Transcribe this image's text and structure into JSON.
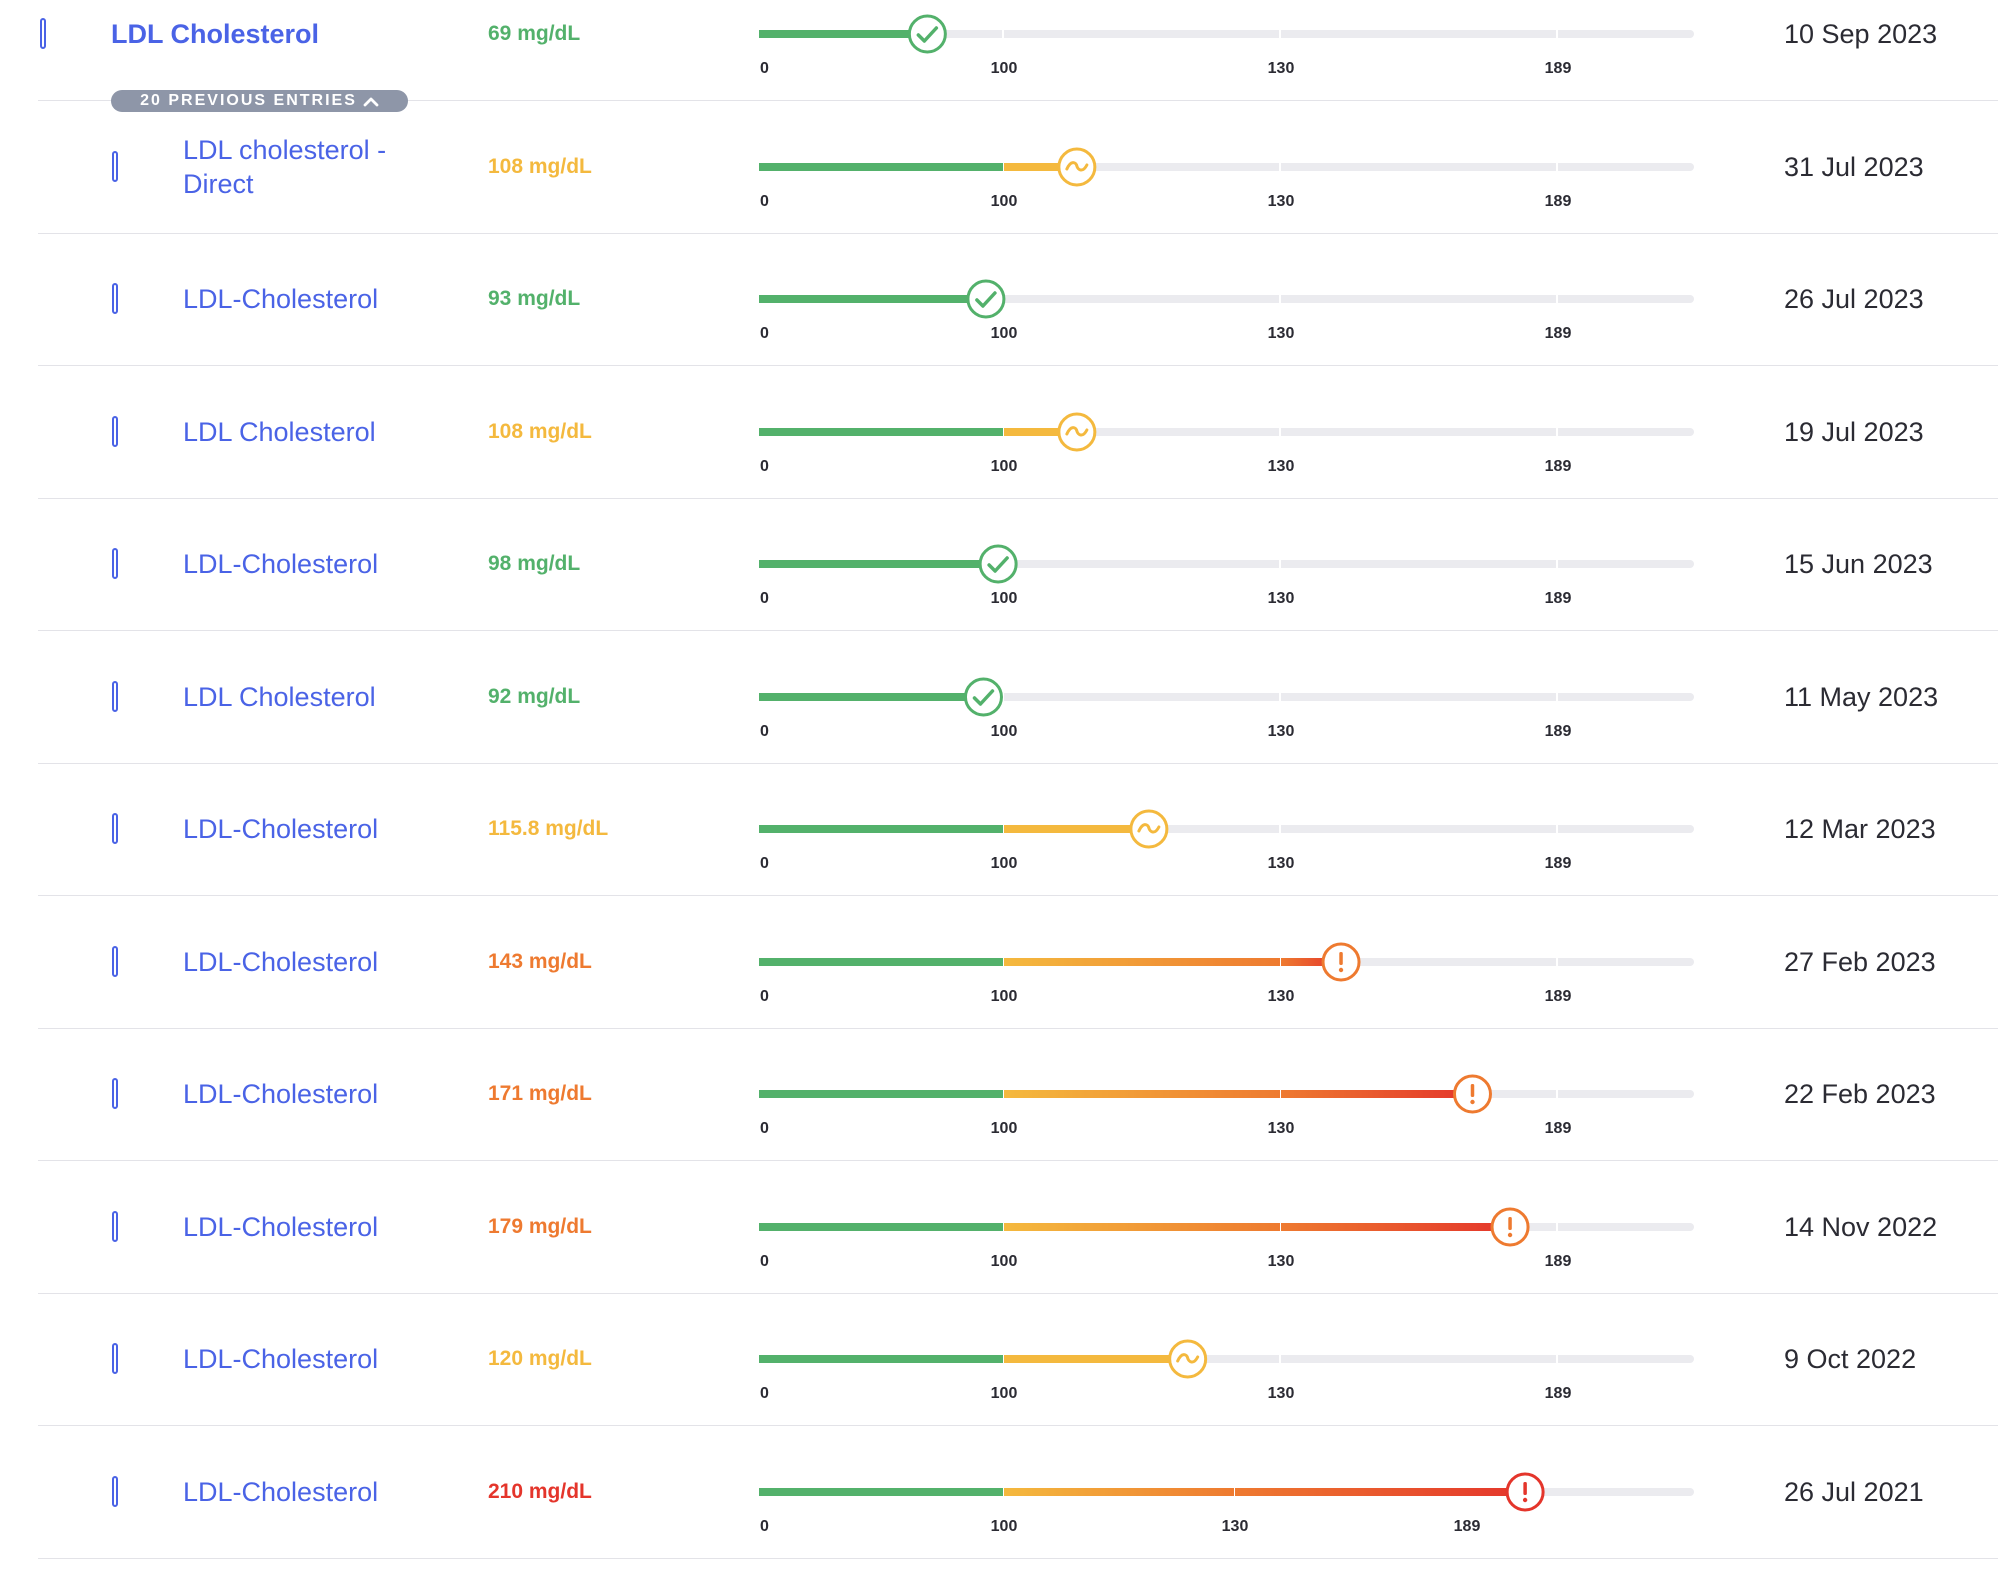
{
  "expander": {
    "label": "20 PREVIOUS ENTRIES",
    "icon": "chevron-up-icon"
  },
  "scale": {
    "ticks": [
      "0",
      "100",
      "130",
      "189"
    ],
    "domain": [
      0,
      270
    ]
  },
  "colors": {
    "name": "#4a63e6",
    "track": "#ebebef",
    "green": "#53b16b",
    "yellow": "#f4b93e",
    "orange": "#ee7a30",
    "red": "#e4352b",
    "date": "#2b2b33"
  },
  "entries": [
    {
      "name": "LDL Cholesterol",
      "value": 69,
      "value_text": "69 mg/dL",
      "status": "green",
      "icon": "check-icon",
      "date": "10 Sep 2023",
      "primary": true
    },
    {
      "name": "LDL cholesterol - Direct",
      "value": 108,
      "value_text": "108 mg/dL",
      "status": "yellow",
      "icon": "tilde-icon",
      "date": "31 Jul 2023"
    },
    {
      "name": "LDL-Cholesterol",
      "value": 93,
      "value_text": "93 mg/dL",
      "status": "green",
      "icon": "check-icon",
      "date": "26 Jul 2023"
    },
    {
      "name": "LDL Cholesterol",
      "value": 108,
      "value_text": "108 mg/dL",
      "status": "yellow",
      "icon": "tilde-icon",
      "date": "19 Jul 2023"
    },
    {
      "name": "LDL-Cholesterol",
      "value": 98,
      "value_text": "98 mg/dL",
      "status": "green",
      "icon": "check-icon",
      "date": "15 Jun 2023"
    },
    {
      "name": "LDL Cholesterol",
      "value": 92,
      "value_text": "92 mg/dL",
      "status": "green",
      "icon": "check-icon",
      "date": "11 May 2023"
    },
    {
      "name": "LDL-Cholesterol",
      "value": 115.8,
      "value_text": "115.8 mg/dL",
      "status": "yellow",
      "icon": "tilde-icon",
      "date": "12 Mar 2023"
    },
    {
      "name": "LDL-Cholesterol",
      "value": 143,
      "value_text": "143 mg/dL",
      "status": "orange",
      "icon": "exclamation-icon",
      "date": "27 Feb 2023"
    },
    {
      "name": "LDL-Cholesterol",
      "value": 171,
      "value_text": "171 mg/dL",
      "status": "orange",
      "icon": "exclamation-icon",
      "date": "22 Feb 2023"
    },
    {
      "name": "LDL-Cholesterol",
      "value": 179,
      "value_text": "179 mg/dL",
      "status": "orange",
      "icon": "exclamation-icon",
      "date": "14 Nov 2022"
    },
    {
      "name": "LDL-Cholesterol",
      "value": 120,
      "value_text": "120 mg/dL",
      "status": "yellow",
      "icon": "tilde-icon",
      "date": "9 Oct 2022"
    },
    {
      "name": "LDL-Cholesterol",
      "value": 210,
      "value_text": "210 mg/dL",
      "status": "red",
      "icon": "exclamation-icon",
      "date": "26 Jul 2021"
    }
  ]
}
